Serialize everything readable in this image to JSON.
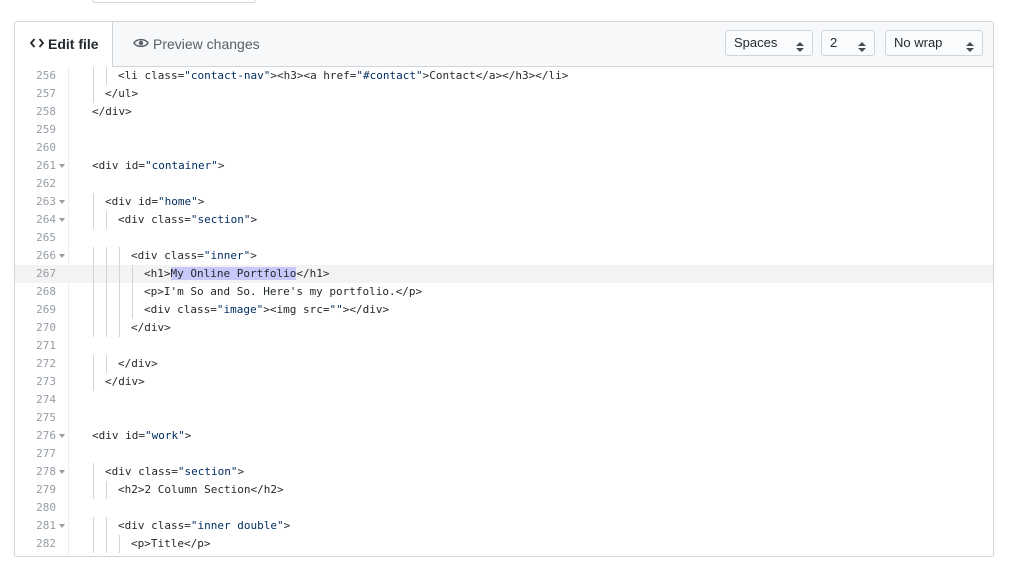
{
  "tabs": {
    "edit_label": "Edit file",
    "preview_label": "Preview changes"
  },
  "settings": {
    "indent_mode": "Spaces",
    "indent_size": "2",
    "wrap_mode": "No wrap"
  },
  "code": {
    "lines": [
      {
        "n": "256",
        "indent": 2,
        "fold": false,
        "tokens": [
          {
            "t": "<li class="
          },
          {
            "t": "\"contact-nav\"",
            "s": 1
          },
          {
            "t": "><h3><a href="
          },
          {
            "t": "\"#contact\"",
            "s": 1
          },
          {
            "t": ">Contact</a></h3></li>"
          }
        ]
      },
      {
        "n": "257",
        "indent": 1,
        "fold": false,
        "tokens": [
          {
            "t": "</ul>"
          }
        ]
      },
      {
        "n": "258",
        "indent": 0,
        "fold": false,
        "tokens": [
          {
            "t": "</div>"
          }
        ]
      },
      {
        "n": "259",
        "indent": 0,
        "fold": false,
        "tokens": []
      },
      {
        "n": "260",
        "indent": 0,
        "fold": false,
        "tokens": []
      },
      {
        "n": "261",
        "indent": 0,
        "fold": true,
        "tokens": [
          {
            "t": "<div id="
          },
          {
            "t": "\"container\"",
            "s": 1
          },
          {
            "t": ">"
          }
        ]
      },
      {
        "n": "262",
        "indent": 0,
        "fold": false,
        "tokens": []
      },
      {
        "n": "263",
        "indent": 1,
        "fold": true,
        "tokens": [
          {
            "t": "<div id="
          },
          {
            "t": "\"home\"",
            "s": 1
          },
          {
            "t": ">"
          }
        ]
      },
      {
        "n": "264",
        "indent": 2,
        "fold": true,
        "tokens": [
          {
            "t": "<div class="
          },
          {
            "t": "\"section\"",
            "s": 1
          },
          {
            "t": ">"
          }
        ]
      },
      {
        "n": "265",
        "indent": 0,
        "fold": false,
        "tokens": []
      },
      {
        "n": "266",
        "indent": 3,
        "fold": true,
        "tokens": [
          {
            "t": "<div class="
          },
          {
            "t": "\"inner\"",
            "s": 1
          },
          {
            "t": ">"
          }
        ]
      },
      {
        "n": "267",
        "indent": 4,
        "fold": false,
        "active": true,
        "tokens": [
          {
            "t": "<h1>"
          },
          {
            "t": "My Online Portfolio",
            "h": 1
          },
          {
            "t": "</h1>"
          }
        ]
      },
      {
        "n": "268",
        "indent": 4,
        "fold": false,
        "tokens": [
          {
            "t": "<p>I'm So and So. Here's my portfolio.</p>"
          }
        ]
      },
      {
        "n": "269",
        "indent": 4,
        "fold": false,
        "tokens": [
          {
            "t": "<div class="
          },
          {
            "t": "\"image\"",
            "s": 1
          },
          {
            "t": "><img src="
          },
          {
            "t": "\"\"",
            "s": 1
          },
          {
            "t": "></div>"
          }
        ]
      },
      {
        "n": "270",
        "indent": 3,
        "fold": false,
        "tokens": [
          {
            "t": "</div>"
          }
        ]
      },
      {
        "n": "271",
        "indent": 0,
        "fold": false,
        "tokens": []
      },
      {
        "n": "272",
        "indent": 2,
        "fold": false,
        "tokens": [
          {
            "t": "</div>"
          }
        ]
      },
      {
        "n": "273",
        "indent": 1,
        "fold": false,
        "tokens": [
          {
            "t": "</div>"
          }
        ]
      },
      {
        "n": "274",
        "indent": 0,
        "fold": false,
        "tokens": []
      },
      {
        "n": "275",
        "indent": 0,
        "fold": false,
        "tokens": []
      },
      {
        "n": "276",
        "indent": 0,
        "fold": true,
        "tokens": [
          {
            "t": "<div id="
          },
          {
            "t": "\"work\"",
            "s": 1
          },
          {
            "t": ">"
          }
        ]
      },
      {
        "n": "277",
        "indent": 0,
        "fold": false,
        "tokens": []
      },
      {
        "n": "278",
        "indent": 1,
        "fold": true,
        "tokens": [
          {
            "t": "<div class="
          },
          {
            "t": "\"section\"",
            "s": 1
          },
          {
            "t": ">"
          }
        ]
      },
      {
        "n": "279",
        "indent": 2,
        "fold": false,
        "tokens": [
          {
            "t": "<h2>2 Column Section</h2>"
          }
        ]
      },
      {
        "n": "280",
        "indent": 0,
        "fold": false,
        "tokens": []
      },
      {
        "n": "281",
        "indent": 2,
        "fold": true,
        "tokens": [
          {
            "t": "<div class="
          },
          {
            "t": "\"inner double\"",
            "s": 1
          },
          {
            "t": ">"
          }
        ]
      },
      {
        "n": "282",
        "indent": 3,
        "fold": false,
        "tokens": [
          {
            "t": "<p>Title</p>"
          }
        ]
      }
    ]
  },
  "colors": {
    "string": "#032f62",
    "selection": "#c8c8fa",
    "active_line": "#f3f3f3",
    "line_number": "#959da5"
  },
  "icons": {
    "edit_tab": "code-brackets-icon",
    "preview_tab": "eye-icon",
    "select_caret": "up-down-caret-icon",
    "fold_marker": "caret-down-icon"
  }
}
